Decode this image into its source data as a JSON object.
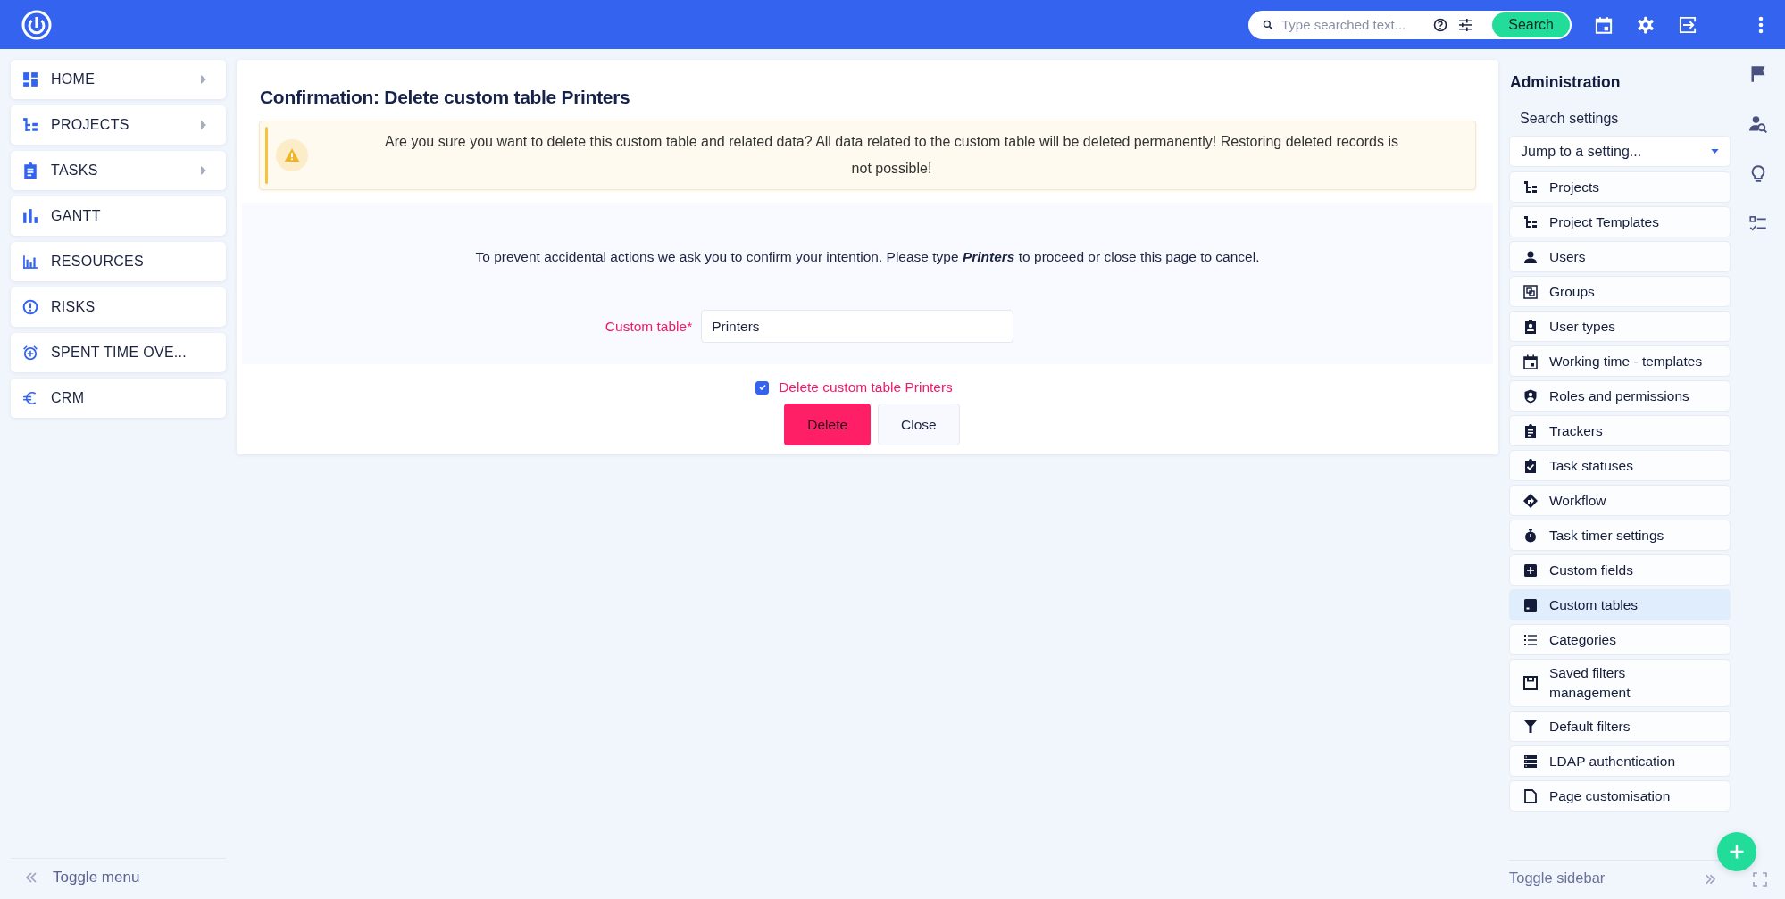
{
  "topbar": {
    "search": {
      "placeholder": "Type searched text...",
      "button": "Search"
    }
  },
  "menu": {
    "items": [
      {
        "label": "HOME",
        "expandable": true
      },
      {
        "label": "PROJECTS",
        "expandable": true
      },
      {
        "label": "TASKS",
        "expandable": true
      },
      {
        "label": "GANTT",
        "expandable": false
      },
      {
        "label": "RESOURCES",
        "expandable": false
      },
      {
        "label": "RISKS",
        "expandable": false
      },
      {
        "label": "SPENT TIME OVE...",
        "expandable": false
      },
      {
        "label": "CRM",
        "expandable": false
      }
    ],
    "toggle": "Toggle menu"
  },
  "page": {
    "title": "Confirmation: Delete custom table Printers",
    "warning": "Are you sure you want to delete this custom table and related data? All data related to the custom table will be deleted permanently! Restoring deleted records is not possible!",
    "instruction": "To prevent accidental actions we ask you to confirm your intention. Please type **Printers** to proceed or close this page to cancel.",
    "field": {
      "label": "Custom table*",
      "value": "Printers"
    },
    "checkbox": {
      "label": "Delete custom table Printers",
      "checked": true
    },
    "buttons": [
      {
        "label": "Delete",
        "kind": "primary"
      },
      {
        "label": "Close",
        "kind": "secondary"
      }
    ]
  },
  "admin": {
    "title": "Administration",
    "search_label": "Search settings",
    "jump": "Jump to a setting...",
    "items": [
      {
        "label": "Projects",
        "selected": false
      },
      {
        "label": "Project Templates",
        "selected": false
      },
      {
        "label": "Users",
        "selected": false
      },
      {
        "label": "Groups",
        "selected": false
      },
      {
        "label": "User types",
        "selected": false
      },
      {
        "label": "Working time - templates",
        "selected": false
      },
      {
        "label": "Roles and permissions",
        "selected": false
      },
      {
        "label": "Trackers",
        "selected": false
      },
      {
        "label": "Task statuses",
        "selected": false
      },
      {
        "label": "Workflow",
        "selected": false
      },
      {
        "label": "Task timer settings",
        "selected": false
      },
      {
        "label": "Custom fields",
        "selected": false
      },
      {
        "label": "Custom tables",
        "selected": true
      },
      {
        "label": "Categories",
        "selected": false
      },
      {
        "label": "Saved filters management",
        "selected": false
      },
      {
        "label": "Default filters",
        "selected": false
      },
      {
        "label": "LDAP authentication",
        "selected": false
      },
      {
        "label": "Page customisation",
        "selected": false
      }
    ],
    "toggle": "Toggle sidebar"
  }
}
